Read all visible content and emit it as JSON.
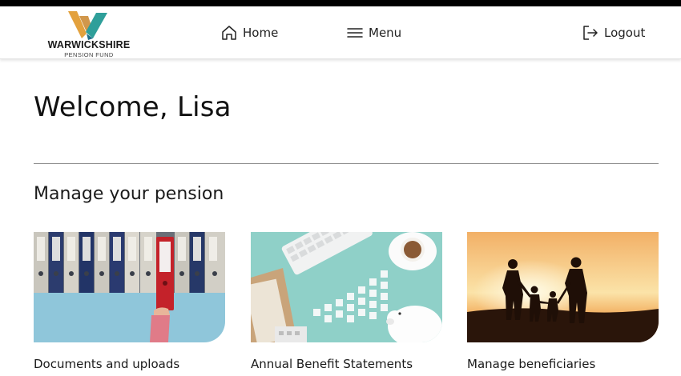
{
  "brand": {
    "name": "WARWICKSHIRE",
    "subtitle": "PENSION FUND",
    "colors": {
      "orange": "#e3a13d",
      "teal": "#2f9f9a"
    }
  },
  "nav": {
    "home_label": "Home",
    "menu_label": "Menu",
    "logout_label": "Logout"
  },
  "main": {
    "welcome": "Welcome, Lisa",
    "section_title": "Manage your pension",
    "cards": [
      {
        "title": "Documents and uploads",
        "image": "binders-photo"
      },
      {
        "title": "Annual Benefit Statements",
        "image": "desk-piggybank-photo"
      },
      {
        "title": "Manage beneficiaries",
        "image": "family-sunset-photo"
      }
    ]
  }
}
